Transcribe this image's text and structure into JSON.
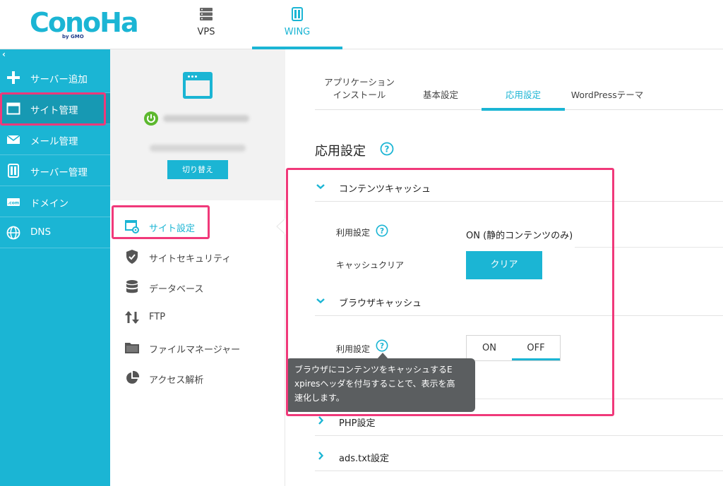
{
  "header": {
    "logo_text": "ConoHa",
    "logo_sub": "by GMO",
    "nav": [
      {
        "label": "VPS",
        "icon": "server-icon"
      },
      {
        "label": "WING",
        "icon": "server-wing-icon",
        "active": true
      }
    ]
  },
  "sidebar": {
    "collapse_glyph": "‹",
    "items": [
      {
        "label": "サーバー追加",
        "icon": "plus-icon"
      },
      {
        "label": "サイト管理",
        "icon": "browser-window-icon",
        "active": true
      },
      {
        "label": "メール管理",
        "icon": "mail-icon"
      },
      {
        "label": "サーバー管理",
        "icon": "server-manage-icon"
      },
      {
        "label": "ドメイン",
        "icon": "domain-icon"
      },
      {
        "label": "DNS",
        "icon": "globe-icon"
      }
    ]
  },
  "site_panel": {
    "switch_label": "切り替え",
    "menu": [
      {
        "label": "サイト設定",
        "icon": "site-settings-icon",
        "active": true
      },
      {
        "label": "サイトセキュリティ",
        "icon": "shield-icon"
      },
      {
        "label": "データベース",
        "icon": "database-icon"
      },
      {
        "label": "FTP",
        "icon": "ftp-arrows-icon"
      },
      {
        "label": "ファイルマネージャー",
        "icon": "folder-icon"
      },
      {
        "label": "アクセス解析",
        "icon": "pie-chart-icon"
      }
    ]
  },
  "main": {
    "tabs": [
      {
        "label_line1": "アプリケーション",
        "label_line2": "インストール"
      },
      {
        "label": "基本設定"
      },
      {
        "label": "応用設定",
        "active": true
      },
      {
        "label": "WordPressテーマ"
      }
    ],
    "section_title": "応用設定",
    "content_cache": {
      "title": "コンテンツキャッシュ",
      "usage_label": "利用設定",
      "usage_value": "ON (静的コンテンツのみ)",
      "clear_label": "キャッシュクリア",
      "clear_button": "クリア"
    },
    "browser_cache": {
      "title": "ブラウザキャッシュ",
      "usage_label": "利用設定",
      "toggle_on": "ON",
      "toggle_off": "OFF",
      "selected": "OFF",
      "tooltip_line1": "ブラウザにコンテンツをキャッシュするE",
      "tooltip_line2": "xpiresヘッダを付与することで、表示を高",
      "tooltip_line3": "速化します。"
    },
    "php_settings": "PHP設定",
    "ads_settings": "ads.txt設定"
  },
  "colors": {
    "accent": "#1bb5d4",
    "sidebar_active": "#1799b3",
    "highlight": "#f0397a",
    "tooltip_bg": "#5b5e60",
    "power_green": "#5cb82e"
  }
}
